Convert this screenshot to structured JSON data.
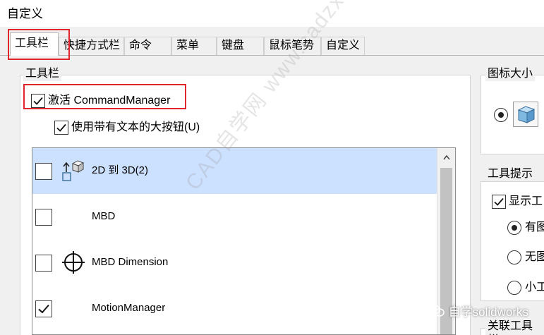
{
  "window": {
    "title": "自定义"
  },
  "tabs": [
    {
      "label": "工具栏",
      "active": true
    },
    {
      "label": "快捷方式栏"
    },
    {
      "label": "命令"
    },
    {
      "label": "菜单"
    },
    {
      "label": "键盘"
    },
    {
      "label": "鼠标笔势"
    },
    {
      "label": "自定义"
    }
  ],
  "toolbars_group": {
    "label": "工具栏",
    "activate_command_manager": {
      "label": "激活 CommandManager",
      "checked": true
    },
    "use_large_buttons": {
      "label": "使用带有文本的大按钮(U)",
      "checked": true
    },
    "items": [
      {
        "label": "2D 到 3D(2)",
        "checked": false,
        "selected": true,
        "icon": "2d-to-3d-icon"
      },
      {
        "label": "MBD",
        "checked": false,
        "selected": false,
        "icon": ""
      },
      {
        "label": "MBD Dimension",
        "checked": false,
        "selected": false,
        "icon": "crosshair-icon"
      },
      {
        "label": "MotionManager",
        "checked": true,
        "selected": false,
        "icon": ""
      }
    ]
  },
  "icon_size_group": {
    "label": "图标大小",
    "selected_icon": "small-cube-icon"
  },
  "tooltips_group": {
    "label": "工具提示",
    "show_tooltips": {
      "label": "显示工",
      "checked": true
    },
    "options": [
      {
        "label": "有图",
        "selected": true
      },
      {
        "label": "无图",
        "selected": false
      },
      {
        "label": "小工",
        "selected": false
      }
    ]
  },
  "context_toolbar_group": {
    "label": "关联工具栏"
  },
  "watermark": {
    "text": "CAD自学网 www.cadzxw.com"
  },
  "brand": {
    "text": "自学solidworks"
  },
  "colors": {
    "highlight_red": "#e0262b",
    "selection_blue": "#cce0ff"
  }
}
